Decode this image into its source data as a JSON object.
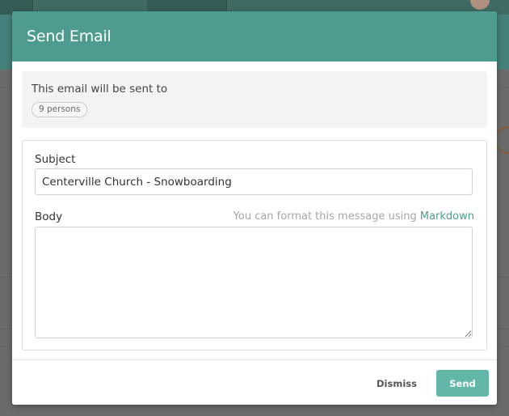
{
  "modal": {
    "title": "Send Email",
    "recipients_text": "This email will be sent to",
    "recipients_badge": "9 persons",
    "subject_label": "Subject",
    "subject_value": "Centerville Church - Snowboarding",
    "body_label": "Body",
    "format_hint_prefix": "You can format this message using",
    "format_hint_link": "Markdown",
    "body_value": "",
    "dismiss_label": "Dismiss",
    "send_label": "Send"
  },
  "colors": {
    "header": "#4e9b8f",
    "send_button": "#62b7a9",
    "link": "#4e9b8f"
  }
}
